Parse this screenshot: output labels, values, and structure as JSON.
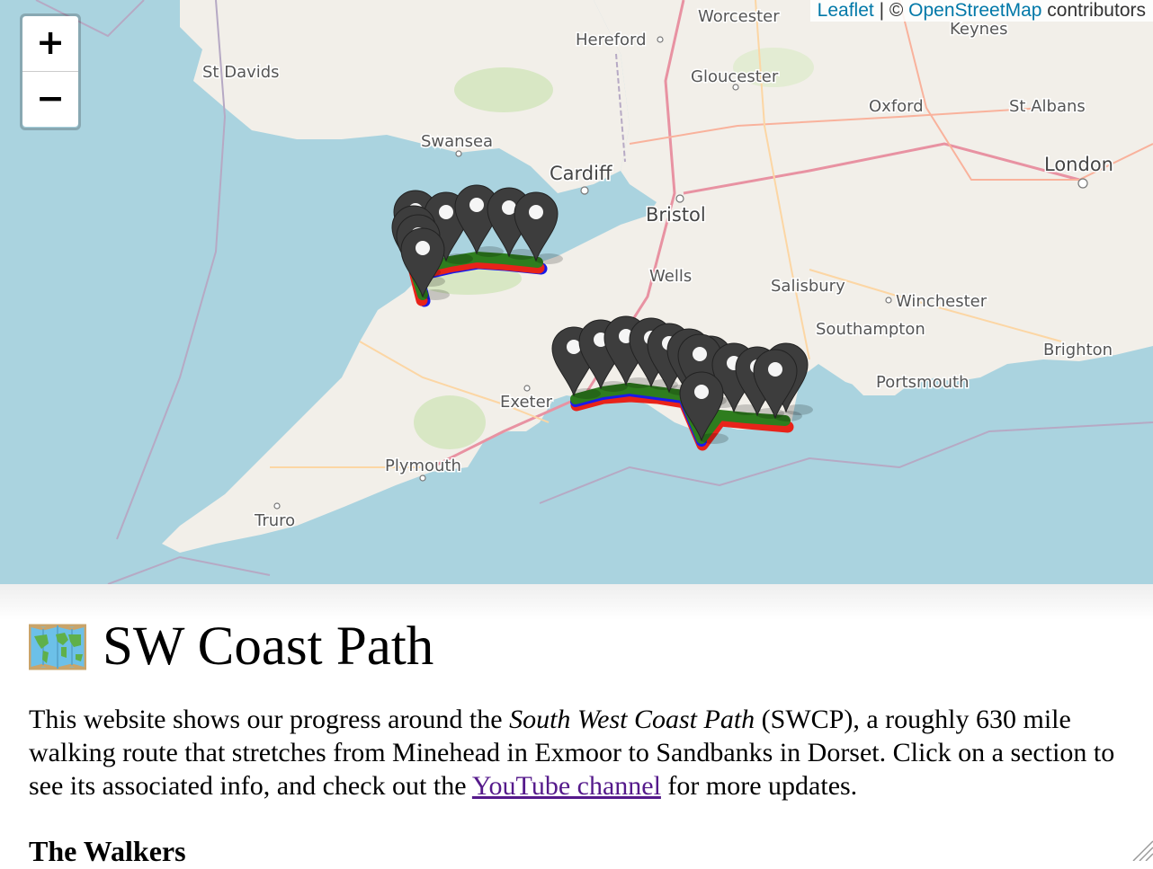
{
  "map": {
    "zoom_in_label": "+",
    "zoom_out_label": "−",
    "attribution": {
      "leaflet": "Leaflet",
      "separator": " | © ",
      "osm": "OpenStreetMap",
      "suffix": " contributors"
    },
    "places": {
      "worcester": "Worcester",
      "hereford": "Hereford",
      "keynes": "Keynes",
      "st_davids": "St Davids",
      "gloucester": "Gloucester",
      "oxford": "Oxford",
      "st_albans": "St Albans",
      "swansea": "Swansea",
      "cardiff": "Cardiff",
      "london": "London",
      "bristol": "Bristol",
      "wells": "Wells",
      "salisbury": "Salisbury",
      "winchester": "Winchester",
      "southampton": "Southampton",
      "brighton": "Brighton",
      "portsmouth": "Portsmouth",
      "exeter": "Exeter",
      "plymouth": "Plymouth",
      "truro": "Truro"
    },
    "colors": {
      "sea": "#aad3df",
      "land": "#f2efe9",
      "route_green": "#2e7d1e",
      "route_red": "#e8231a",
      "route_blue": "#1a1ae8",
      "marker": "#3d3d3d"
    }
  },
  "page": {
    "title": "SW Coast Path",
    "emoji_icon": "world-map-emoji",
    "intro_part1": "This website shows our progress around the ",
    "intro_italic": "South West Coast Path",
    "intro_part2": " (SWCP), a roughly 630 mile walking route that stretches from Minehead in Exmoor to Sandbanks in Dorset. Click on a section to see its associated info, and check out the ",
    "intro_link": "YouTube channel",
    "intro_part3": " for more updates.",
    "walkers_heading": "The Walkers"
  }
}
